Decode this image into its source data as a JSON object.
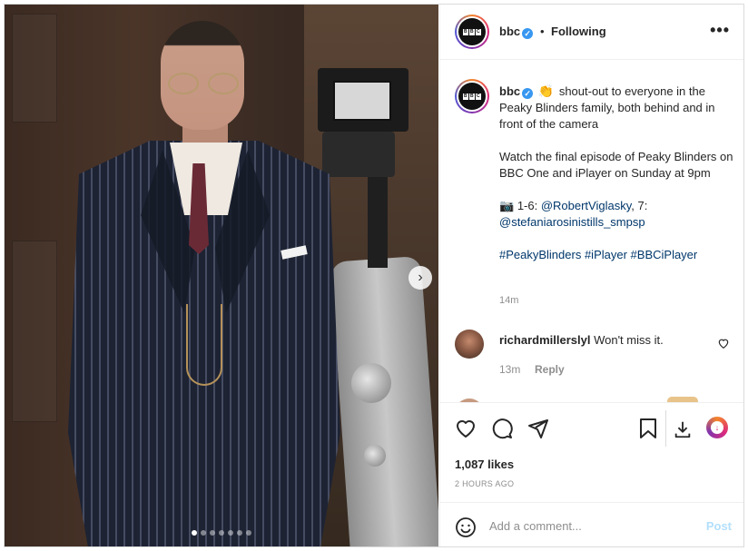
{
  "post": {
    "username": "bbc",
    "avatar_text": "BBC",
    "follow_status": "Following",
    "separator": "•",
    "more_label": "•••",
    "next_label": "›",
    "carousel": {
      "total": 7,
      "active": 1
    },
    "caption": {
      "username": "bbc",
      "clap": "👏",
      "line1": "shout-out to everyone in the Peaky Blinders family, both behind and in front of the camera",
      "line2": "Watch the final episode of Peaky Blinders on BBC One and iPlayer on Sunday at 9pm",
      "camera": "📷",
      "credits_text": "1-6: ",
      "credit1": "@RobertViglasky",
      "credits_mid": ", 7:",
      "credit2": "@stefaniarosinistills_smpsp",
      "hashtag1": "#PeakyBlinders",
      "hashtag2": "#iPlayer",
      "hashtag3": "#BBCiPlayer",
      "time": "14m"
    },
    "comments": [
      {
        "username": "richardmillerslyl",
        "text": "Won't miss it.",
        "time": "13m",
        "reply_label": "Reply"
      }
    ],
    "likes": "1,087 likes",
    "posted_ago": "2 HOURS AGO",
    "comment_input": {
      "placeholder": "Add a comment...",
      "post_label": "Post"
    }
  },
  "colors": {
    "link": "#00376b",
    "verified": "#3897f0",
    "muted": "#8e8e8e",
    "post_disabled": "#b2dffc"
  }
}
